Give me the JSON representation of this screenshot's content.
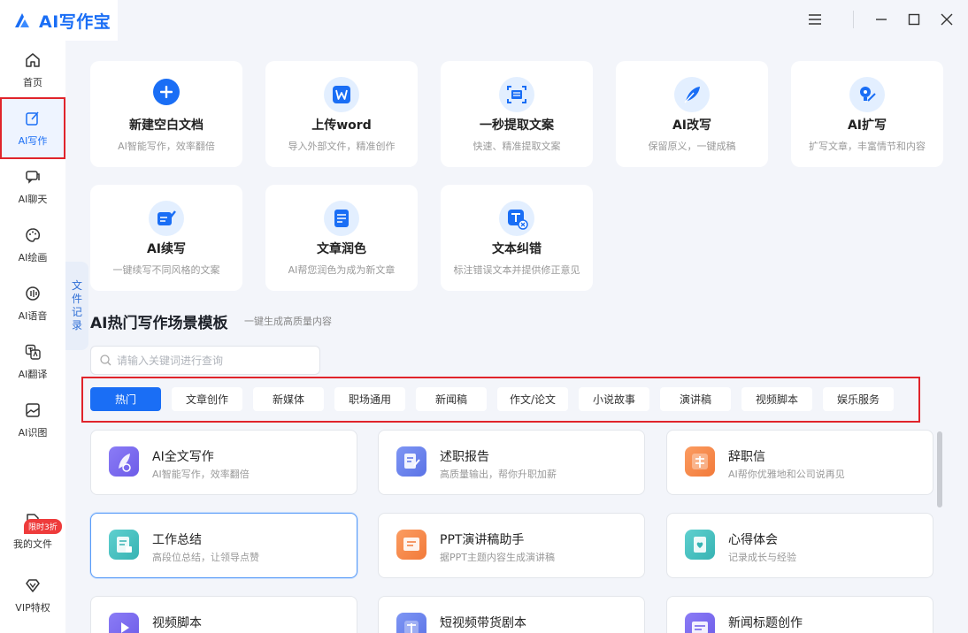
{
  "app": {
    "title": "AI写作宝",
    "brand_color": "#1a6ef5"
  },
  "window": {
    "menu_icon": "menu-icon",
    "minimize_icon": "minimize-icon",
    "maximize_icon": "maximize-icon",
    "close_icon": "close-icon"
  },
  "sidebar": {
    "items": [
      {
        "label": "首页",
        "icon": "home-icon"
      },
      {
        "label": "AI写作",
        "icon": "edit-icon",
        "active": true
      },
      {
        "label": "AI聊天",
        "icon": "chat-icon"
      },
      {
        "label": "AI绘画",
        "icon": "palette-icon"
      },
      {
        "label": "AI语音",
        "icon": "voice-icon"
      },
      {
        "label": "AI翻译",
        "icon": "translate-icon"
      },
      {
        "label": "AI识图",
        "icon": "image-icon"
      }
    ],
    "bottom": [
      {
        "label": "我的文件",
        "icon": "file-icon"
      },
      {
        "label": "VIP特权",
        "icon": "diamond-icon",
        "badge": "限时3折"
      }
    ]
  },
  "file_records_tab": "文件记录",
  "tools": [
    {
      "title": "新建空白文档",
      "desc": "AI智能写作，效率翻倍"
    },
    {
      "title": "上传word",
      "desc": "导入外部文件，精准创作"
    },
    {
      "title": "一秒提取文案",
      "desc": "快速、精准提取文案"
    },
    {
      "title": "AI改写",
      "desc": "保留原义，一键成稿"
    },
    {
      "title": "AI扩写",
      "desc": "扩写文章，丰富情节和内容"
    },
    {
      "title": "AI续写",
      "desc": "一键续写不同风格的文案"
    },
    {
      "title": "文章润色",
      "desc": "AI帮您润色为成为新文章"
    },
    {
      "title": "文本纠错",
      "desc": "标注错误文本并提供修正意见"
    }
  ],
  "templates_section": {
    "title": "AI热门写作场景模板",
    "subtitle": "一键生成高质量内容",
    "search_placeholder": "请输入关键词进行查询",
    "tabs": [
      "热门",
      "文章创作",
      "新媒体",
      "职场通用",
      "新闻稿",
      "作文/论文",
      "小说故事",
      "演讲稿",
      "视频脚本",
      "娱乐服务"
    ],
    "active_tab": "热门",
    "items": [
      {
        "title": "AI全文写作",
        "desc": "AI智能写作，效率翻倍"
      },
      {
        "title": "述职报告",
        "desc": "高质量输出，帮你升职加薪"
      },
      {
        "title": "辞职信",
        "desc": "AI帮你优雅地和公司说再见"
      },
      {
        "title": "工作总结",
        "desc": "高段位总结，让领导点赞"
      },
      {
        "title": "PPT演讲稿助手",
        "desc": "据PPT主题内容生成演讲稿"
      },
      {
        "title": "心得体会",
        "desc": "记录成长与经验"
      },
      {
        "title": "视频脚本",
        "desc": ""
      },
      {
        "title": "短视频带货剧本",
        "desc": ""
      },
      {
        "title": "新闻标题创作",
        "desc": ""
      }
    ]
  }
}
